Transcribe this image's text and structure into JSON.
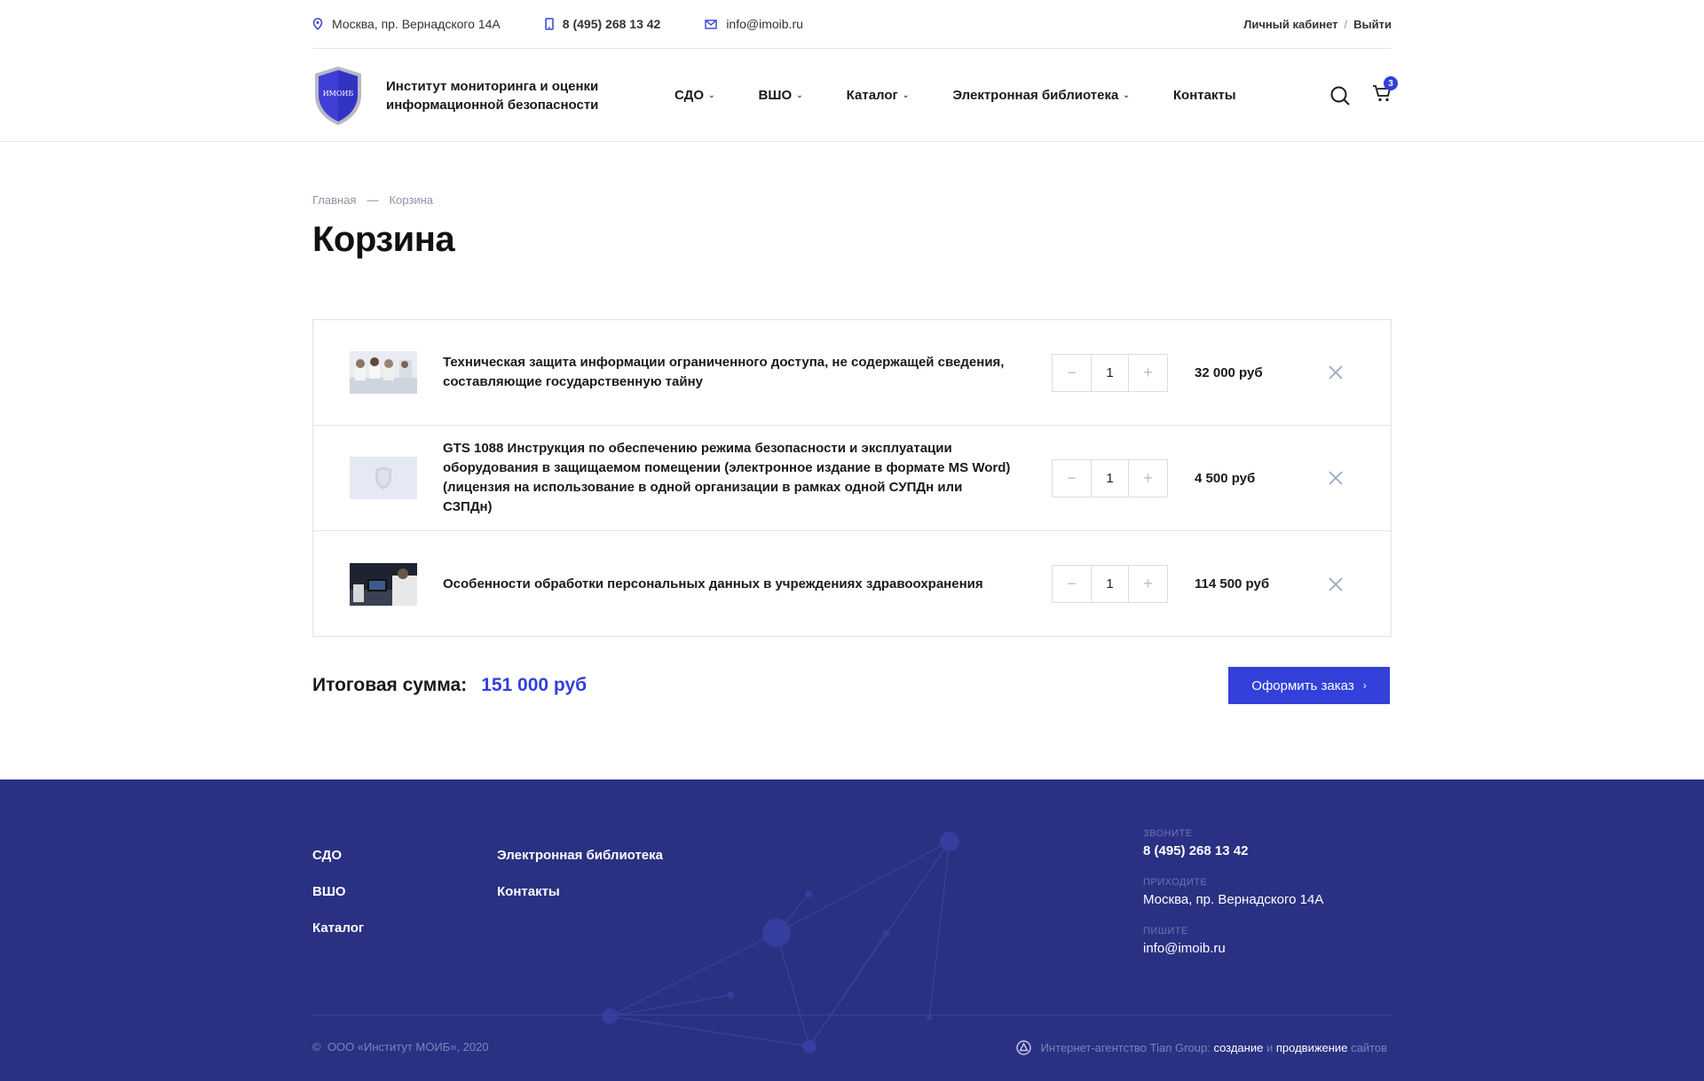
{
  "topbar": {
    "address": "Москва, пр. Вернадского 14А",
    "phone": "8 (495) 268 13 42",
    "email": "info@imoib.ru",
    "account_label": "Личный кабинет",
    "separator": "/",
    "logout_label": "Выйти"
  },
  "header": {
    "logo_text": "ИМОИБ",
    "org_name_line1": "Институт мониторинга и оценки",
    "org_name_line2": "информационной безопасности",
    "nav": [
      "СДО",
      "ВШО",
      "Каталог",
      "Электронная библиотека",
      "Контакты"
    ],
    "cart_count": "3"
  },
  "breadcrumb": {
    "home": "Главная",
    "dash": "—",
    "current": "Корзина"
  },
  "page_title": "Корзина",
  "cart": {
    "items": [
      {
        "name": "Техническая защита информации ограниченного доступа, не содержащей сведения, составляющие государственную тайну",
        "qty": "1",
        "price": "32 000 руб"
      },
      {
        "name": "GTS 1088 Инструкция по обеспечению режима безопасности и эксплуатации оборудования в защищаемом помещении (электронное издание в формате MS Word) (лицензия на использование в одной организации в рамках одной СУПДн или СЗПДн)",
        "qty": "1",
        "price": "4 500 руб"
      },
      {
        "name": "Особенности обработки персональных данных в учреждениях здравоохранения",
        "qty": "1",
        "price": "114 500 руб"
      }
    ],
    "total_label": "Итоговая сумма:",
    "total_value": "151 000 руб",
    "order_button": "Оформить заказ"
  },
  "footer": {
    "col1": [
      "СДО",
      "ВШО",
      "Каталог"
    ],
    "col2": [
      "Электронная библиотека",
      "Контакты"
    ],
    "call_label": "Звоните",
    "phone": "8 (495) 268 13 42",
    "visit_label": "Приходите",
    "address": "Москва, пр. Вернадского 14А",
    "write_label": "Пишите",
    "email": "info@imoib.ru",
    "copyright": "ООО «Институт МОИБ», 2020",
    "agency_prefix": "Интернет-агентство Tian Group:",
    "agency_create": "создание",
    "agency_and": "и",
    "agency_promo": "продвижение",
    "agency_suffix": "сайтов"
  },
  "colors": {
    "accent": "#3340d9",
    "footer_bg": "#2a3183"
  }
}
